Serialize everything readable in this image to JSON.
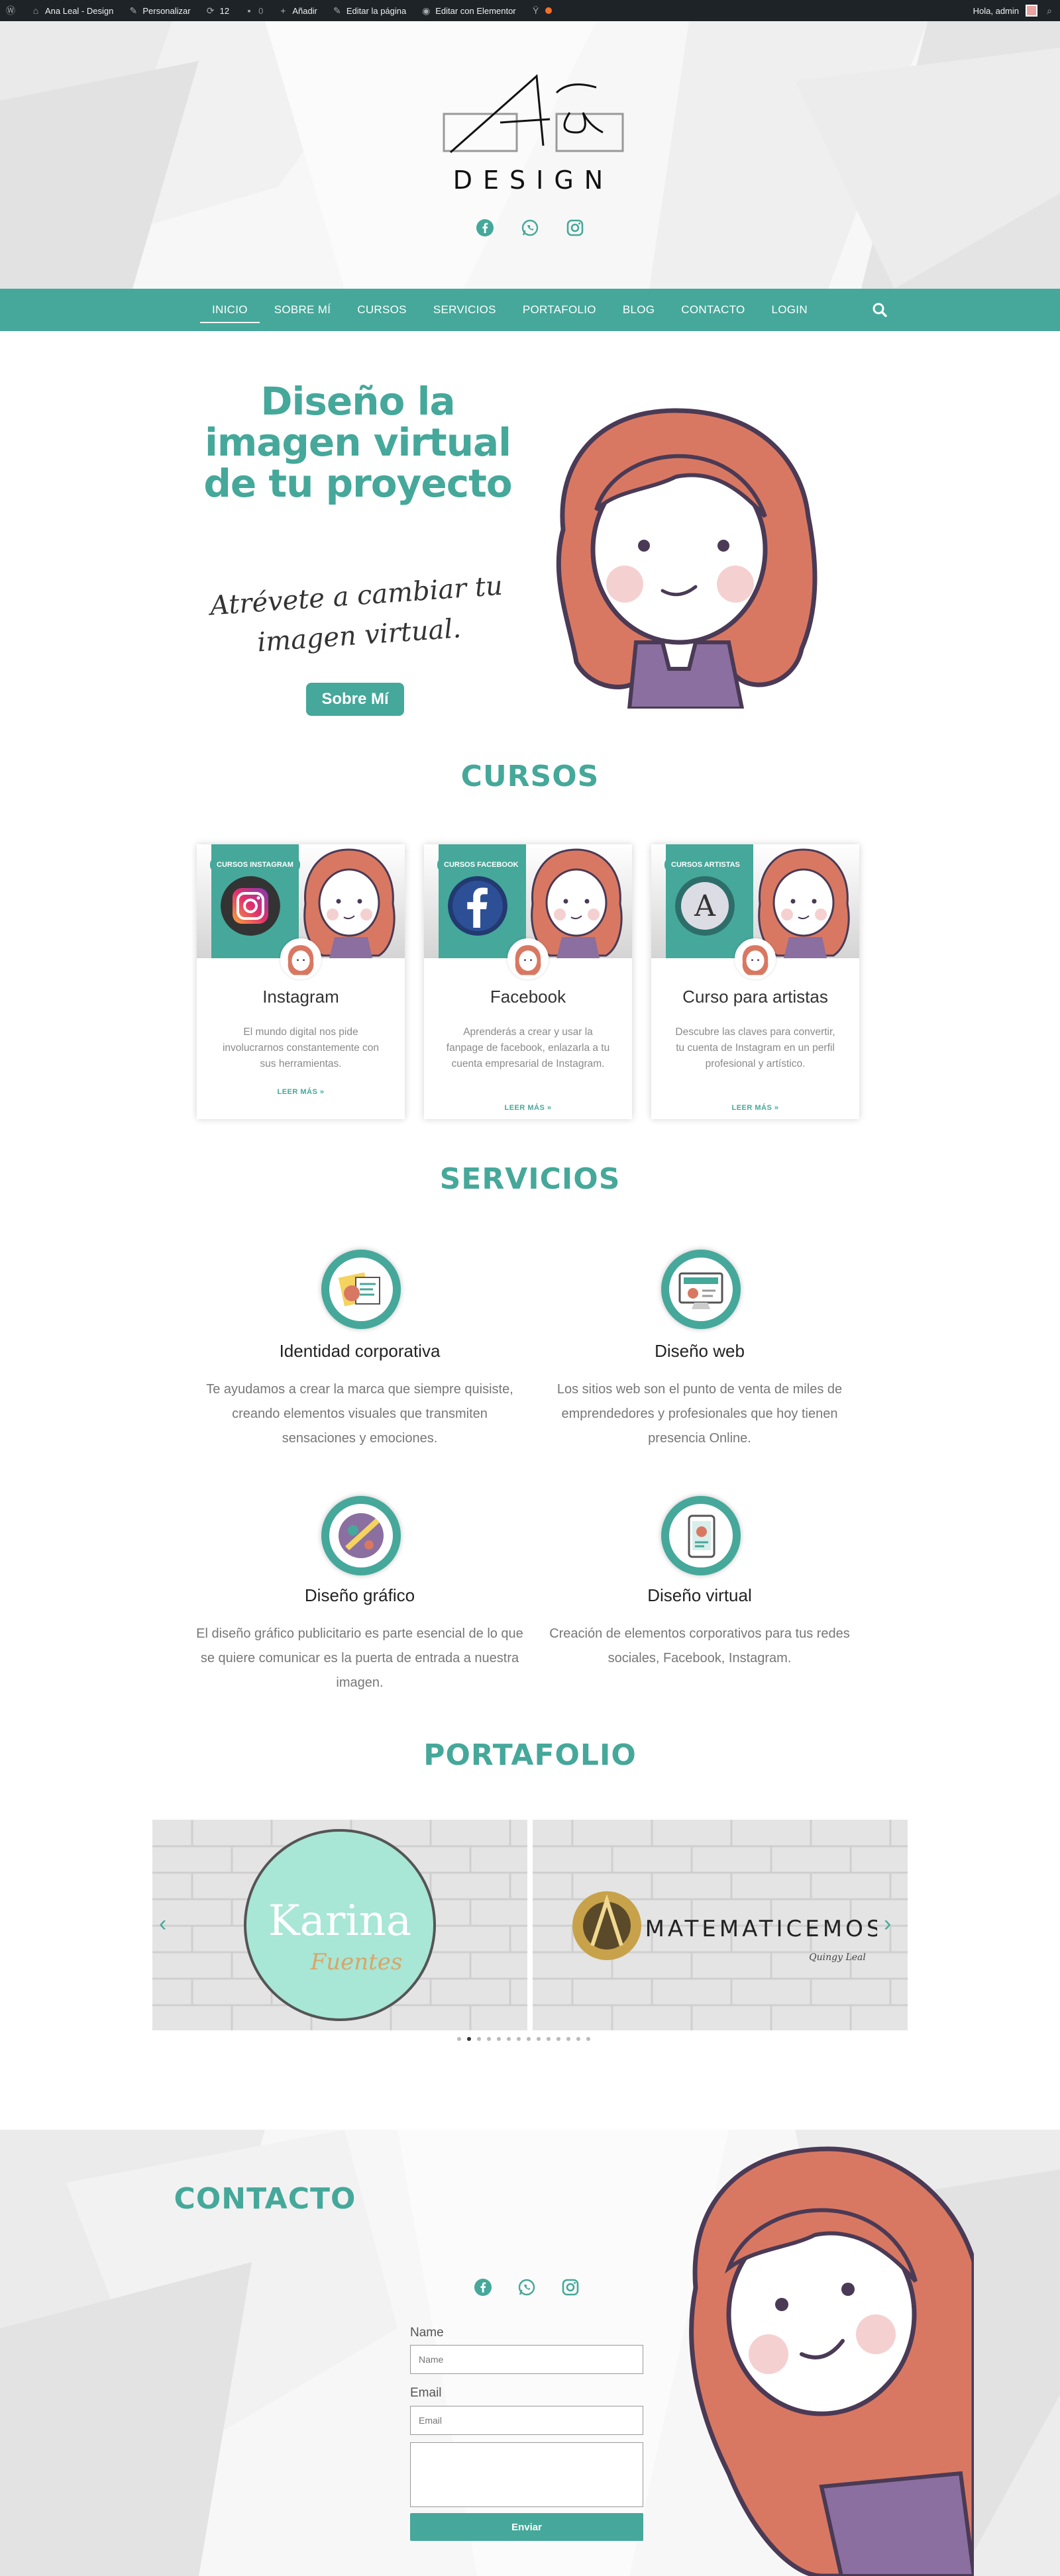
{
  "adminbar": {
    "site": "Ana Leal - Design",
    "customize": "Personalizar",
    "updates": "12",
    "comments": "0",
    "new": "Añadir",
    "edit_page": "Editar la página",
    "edit_elementor": "Editar con Elementor",
    "greeting": "Hola, admin"
  },
  "brand": {
    "logo_script": "Aña",
    "logo_word": "DESIGN",
    "accent": "#45a89a"
  },
  "header_social": [
    "facebook-icon",
    "whatsapp-icon",
    "instagram-icon"
  ],
  "nav": {
    "items": [
      "INICIO",
      "SOBRE MÍ",
      "CURSOS",
      "SERVICIOS",
      "PORTAFOLIO",
      "BLOG",
      "CONTACTO",
      "LOGIN"
    ],
    "active": "INICIO"
  },
  "hero": {
    "title": "Diseño la imagen virtual de tu proyecto",
    "script": "Atrévete a cambiar tu imagen virtual.",
    "button": "Sobre Mí"
  },
  "courses": {
    "heading": "CURSOS",
    "cards": [
      {
        "badge": "CURSOS INSTAGRAM",
        "title": "Instagram",
        "text": "El mundo digital nos pide involucrarnos constantemente con sus herramientas.",
        "link": "LEER MÁS »",
        "logo": "instagram-logo-icon"
      },
      {
        "badge": "CURSOS FACEBOOK",
        "title": "Facebook",
        "text": "Aprenderás a crear y usar la fanpage de facebook, enlazarla a tu cuenta empresarial de Instagram.",
        "link": "LEER MÁS »",
        "logo": "facebook-logo-icon"
      },
      {
        "badge": "CURSOS ARTISTAS",
        "title": "Curso para artistas",
        "text": "Descubre las claves para convertir, tu cuenta de Instagram en un perfil profesional y artístico.",
        "link": "LEER MÁS »",
        "logo": "letter-a-logo-icon",
        "logo_letter": "A"
      }
    ]
  },
  "services": {
    "heading": "SERVICIOS",
    "items": [
      {
        "title": "Identidad corporativa",
        "text": "Te ayudamos a crear la marca que siempre quisiste, creando elementos visuales que transmiten sensaciones y emociones."
      },
      {
        "title": "Diseño web",
        "text": "Los sitios web son el punto de venta de miles de emprendedores y profesionales que hoy tienen presencia Online."
      },
      {
        "title": "Diseño gráfico",
        "text": "El diseño gráfico publicitario es parte esencial de lo que se quiere comunicar es la puerta de entrada a nuestra imagen."
      },
      {
        "title": "Diseño virtual",
        "text": "Creación de elementos corporativos para tus redes sociales, Facebook, Instagram."
      }
    ]
  },
  "portfolio": {
    "heading": "PORTAFOLIO",
    "slides": [
      {
        "logo_text": "Karina",
        "logo_sub": "Fuentes"
      },
      {
        "logo_text": "MATEMATICEMOS",
        "logo_sub": "Quingy Leal"
      }
    ],
    "dot_count": 14,
    "active_dot": 1
  },
  "contact": {
    "heading": "CONTACTO",
    "social": [
      "facebook-icon",
      "whatsapp-icon",
      "instagram-icon"
    ],
    "name_label": "Name",
    "name_placeholder": "Name",
    "email_label": "Email",
    "email_placeholder": "Email",
    "submit": "Enviar"
  }
}
